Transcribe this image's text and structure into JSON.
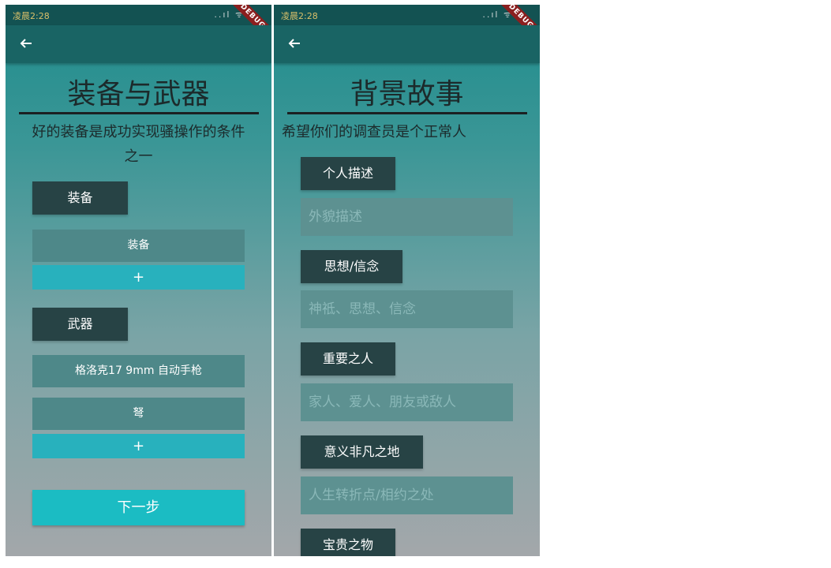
{
  "status": {
    "time": "凌晨2:28",
    "icons": "..ıl ᯤ"
  },
  "debug_label": "DEBUG",
  "equipment_page": {
    "title": "装备与武器",
    "subtitle": "好的装备是成功实现骚操作的条件之一",
    "equipment_section_label": "装备",
    "equipment_items": [
      "装备"
    ],
    "add_label": "+",
    "weapon_section_label": "武器",
    "weapon_items": [
      "格洛克17 9mm 自动手枪",
      "弩"
    ],
    "next_label": "下一步"
  },
  "backstory_page": {
    "title": "背景故事",
    "subtitle": "希望你们的调查员是个正常人",
    "sections": [
      {
        "label": "个人描述",
        "placeholder": "外貌描述"
      },
      {
        "label": "思想/信念",
        "placeholder": "神祗、思想、信念"
      },
      {
        "label": "重要之人",
        "placeholder": "家人、爱人、朋友或敌人"
      },
      {
        "label": "意义非凡之地",
        "placeholder": "人生转折点/相约之处"
      },
      {
        "label": "宝贵之物",
        "placeholder": ""
      }
    ]
  },
  "colors": {
    "appbar": "#196464",
    "section_button": "#274345",
    "add_button": "#28b1bd",
    "next_button": "#1bbcc3"
  }
}
